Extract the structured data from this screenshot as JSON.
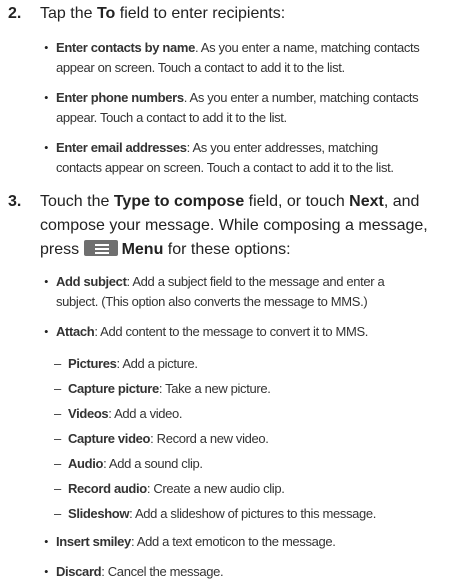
{
  "step2": {
    "number": "2.",
    "intro_a": "Tap the ",
    "intro_bold": "To",
    "intro_b": " field to enter recipients:",
    "bullets": [
      {
        "title": "Enter contacts by name",
        "line1": ". As you enter a name, matching contacts",
        "line2": "appear on screen. Touch a contact to add it to the list."
      },
      {
        "title": "Enter phone numbers",
        "line1": ". As you enter a number, matching contacts",
        "line2": "appear. Touch a contact to add it to the list."
      },
      {
        "title": "Enter email addresses",
        "line1": ": As you enter addresses, matching",
        "line2": "contacts appear on screen. Touch a contact to add it to the list."
      }
    ]
  },
  "step3": {
    "number": "3.",
    "l1_a": "Touch the ",
    "l1_bold1": "Type to compose",
    "l1_b": " field, or touch ",
    "l1_bold2": "Next",
    "l1_c": ", and",
    "l2": "compose your message. While composing a message,",
    "l3_a": "press ",
    "l3_bold": "Menu",
    "l3_b": " for these options:",
    "menu_icon": "menu-icon",
    "bullets": [
      {
        "title": "Add subject",
        "line1": ": Add a subject field to the message and enter a",
        "line2": "subject. (This option also converts the message to MMS.)"
      },
      {
        "title": "Attach",
        "line1": ": Add content to the message to convert it to MMS.",
        "line2": ""
      }
    ],
    "attach_items": [
      {
        "title": "Pictures",
        "desc": ": Add a picture."
      },
      {
        "title": "Capture picture",
        "desc": ": Take a new picture."
      },
      {
        "title": "Videos",
        "desc": ": Add a video."
      },
      {
        "title": "Capture video",
        "desc": ": Record a new video."
      },
      {
        "title": "Audio",
        "desc": ": Add a sound clip."
      },
      {
        "title": "Record audio",
        "desc": ": Create a new audio clip."
      },
      {
        "title": "Slideshow",
        "desc": ": Add a slideshow of pictures to this message."
      }
    ],
    "more_bullets": [
      {
        "title": "Insert smiley",
        "desc": ": Add a text emoticon to the message."
      },
      {
        "title": "Discard",
        "desc": ": Cancel the message."
      }
    ]
  }
}
